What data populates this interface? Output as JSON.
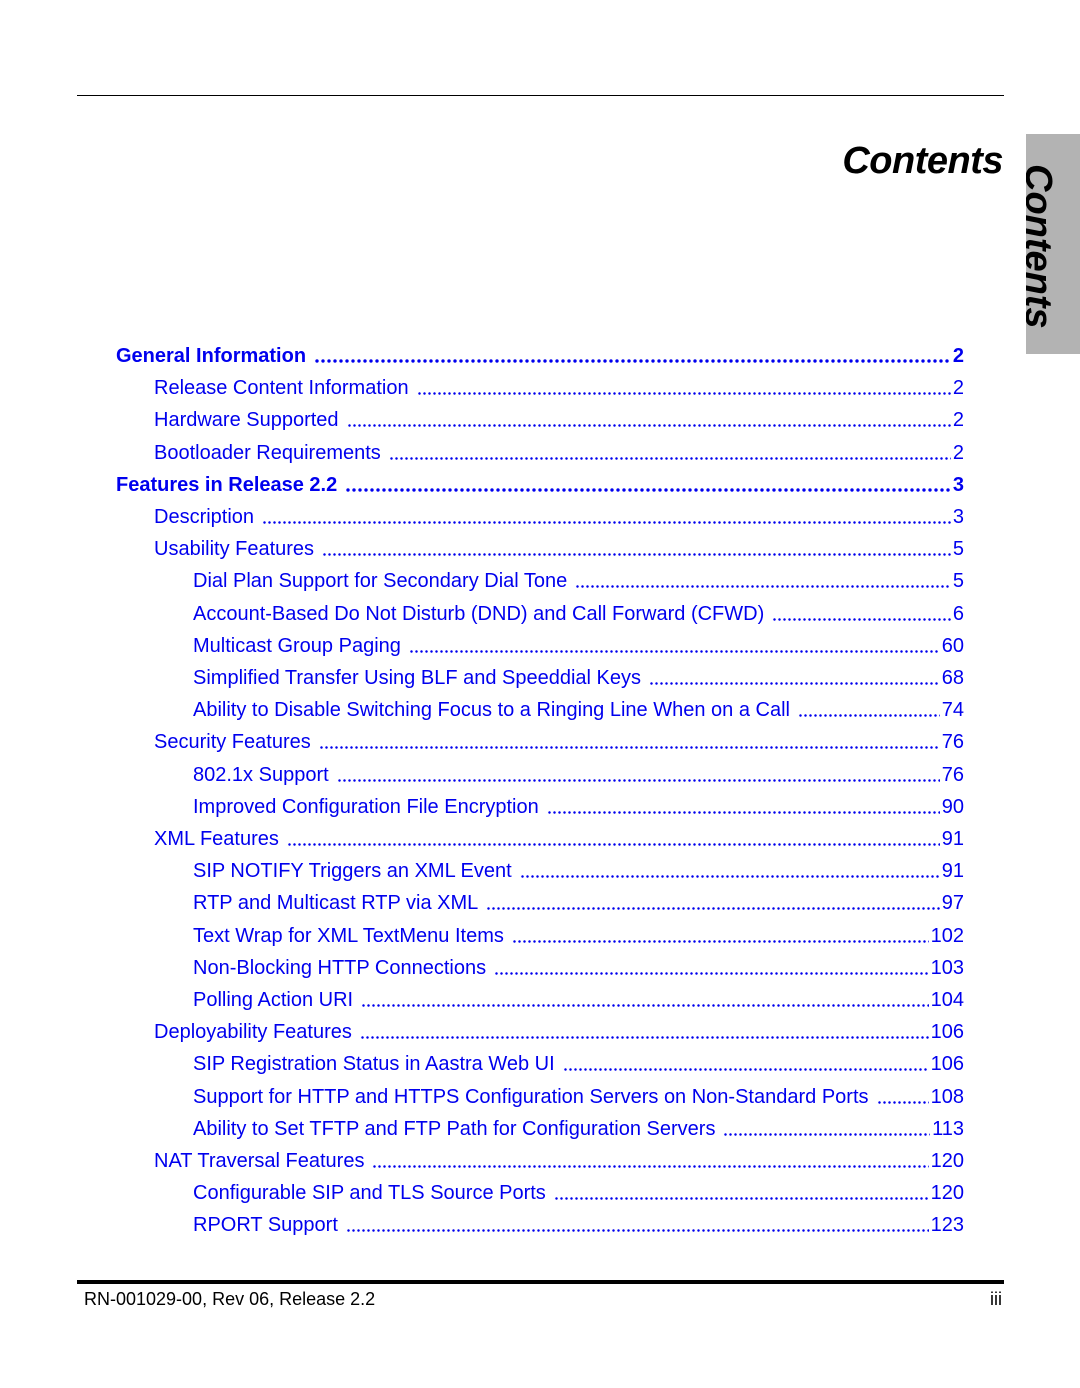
{
  "header": {
    "title": "Contents",
    "side_tab_label": "Contents"
  },
  "colors": {
    "link": "#0000ee",
    "side_tab_bg": "#b3b3b3"
  },
  "toc": [
    {
      "level": 1,
      "title": "General Information",
      "page": "2"
    },
    {
      "level": 2,
      "title": "Release Content Information",
      "page": "2"
    },
    {
      "level": 2,
      "title": "Hardware Supported",
      "page": "2"
    },
    {
      "level": 2,
      "title": "Bootloader Requirements",
      "page": "2"
    },
    {
      "level": 1,
      "title": "Features in Release 2.2",
      "page": "3"
    },
    {
      "level": 2,
      "title": "Description",
      "page": "3"
    },
    {
      "level": 2,
      "title": "Usability Features",
      "page": "5"
    },
    {
      "level": 3,
      "title": "Dial Plan Support for Secondary Dial Tone",
      "page": "5"
    },
    {
      "level": 3,
      "title": "Account-Based Do Not Disturb (DND) and Call Forward (CFWD)",
      "page": "6"
    },
    {
      "level": 3,
      "title": "Multicast Group Paging",
      "page": "60"
    },
    {
      "level": 3,
      "title": "Simplified Transfer Using BLF and Speeddial Keys",
      "page": "68"
    },
    {
      "level": 3,
      "title": "Ability to Disable Switching Focus to a Ringing Line When on a Call",
      "page": "74"
    },
    {
      "level": 2,
      "title": "Security Features",
      "page": "76"
    },
    {
      "level": 3,
      "title": "802.1x Support",
      "page": "76"
    },
    {
      "level": 3,
      "title": "Improved Configuration File Encryption",
      "page": "90"
    },
    {
      "level": 2,
      "title": "XML Features",
      "page": "91"
    },
    {
      "level": 3,
      "title": "SIP NOTIFY Triggers an XML Event",
      "page": "91"
    },
    {
      "level": 3,
      "title": "RTP and Multicast RTP via XML",
      "page": "97"
    },
    {
      "level": 3,
      "title": "Text Wrap for XML TextMenu Items",
      "page": "102"
    },
    {
      "level": 3,
      "title": "Non-Blocking HTTP Connections",
      "page": "103"
    },
    {
      "level": 3,
      "title": "Polling Action URI",
      "page": "104"
    },
    {
      "level": 2,
      "title": "Deployability Features",
      "page": "106"
    },
    {
      "level": 3,
      "title": "SIP Registration Status in Aastra Web UI",
      "page": "106"
    },
    {
      "level": 3,
      "title": "Support for HTTP and HTTPS Configuration Servers on Non-Standard Ports",
      "page": "108"
    },
    {
      "level": 3,
      "title": "Ability to Set TFTP and FTP Path for Configuration Servers",
      "page": "113"
    },
    {
      "level": 2,
      "title": "NAT Traversal Features",
      "page": "120"
    },
    {
      "level": 3,
      "title": "Configurable SIP and TLS Source Ports",
      "page": "120"
    },
    {
      "level": 3,
      "title": "RPORT Support",
      "page": "123"
    }
  ],
  "footer": {
    "document_id": "RN-001029-00, Rev 06, Release 2.2",
    "page_number": "iii"
  }
}
